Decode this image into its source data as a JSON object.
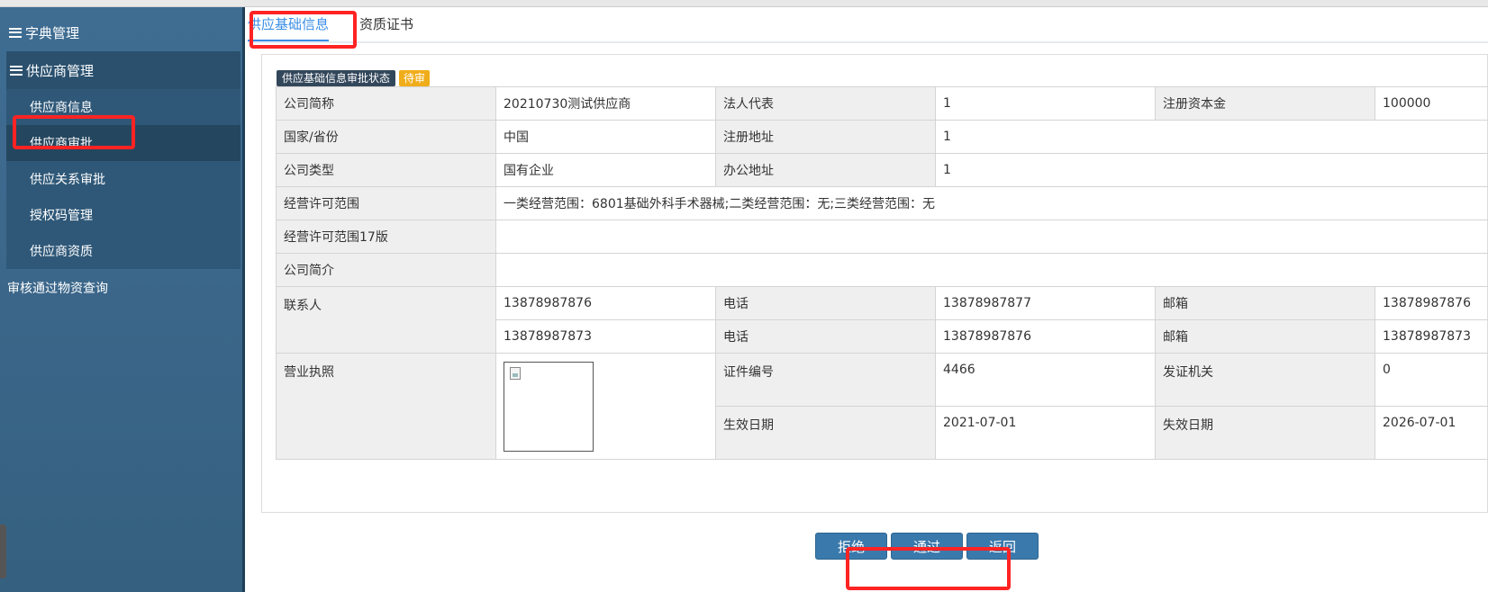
{
  "sidebar": {
    "top_item": "字典管理",
    "group_title": "供应商管理",
    "items": [
      "供应商信息",
      "供应商审批",
      "供应关系审批",
      "授权码管理",
      "供应商资质"
    ],
    "bottom_item": "审核通过物资查询"
  },
  "tabs": [
    "供应基础信息",
    "资质证书"
  ],
  "status": {
    "label": "供应基础信息审批状态",
    "badge": "待审"
  },
  "table": {
    "company_short_k": "公司简称",
    "company_short_v": "20210730测试供应商",
    "legal_rep_k": "法人代表",
    "legal_rep_v": "1",
    "capital_k": "注册资本金",
    "capital_v": "100000",
    "country_k": "国家/省份",
    "country_v": "中国",
    "reg_addr_k": "注册地址",
    "reg_addr_v": "1",
    "type_k": "公司类型",
    "type_v": "国有企业",
    "office_k": "办公地址",
    "office_v": "1",
    "scope_k": "经营许可范围",
    "scope_v": "一类经营范围：6801基础外科手术器械;二类经营范围：无;三类经营范围：无",
    "scope17_k": "经营许可范围17版",
    "scope17_v": "",
    "intro_k": "公司简介",
    "intro_v": "",
    "contact_k": "联系人",
    "contacts": [
      {
        "name": "13878987876",
        "phone_k": "电话",
        "phone": "13878987877",
        "email_k": "邮箱",
        "email": "13878987876"
      },
      {
        "name": "13878987873",
        "phone_k": "电话",
        "phone": "13878987876",
        "email_k": "邮箱",
        "email": "13878987873"
      }
    ],
    "license_k": "营业执照",
    "cert_no_k": "证件编号",
    "cert_no_v": "4466",
    "issuer_k": "发证机关",
    "issuer_v": "0",
    "valid_from_k": "生效日期",
    "valid_from_v": "2021-07-01",
    "valid_to_k": "失效日期",
    "valid_to_v": "2026-07-01"
  },
  "buttons": {
    "reject": "拒绝",
    "approve": "通过",
    "back": "返回"
  }
}
